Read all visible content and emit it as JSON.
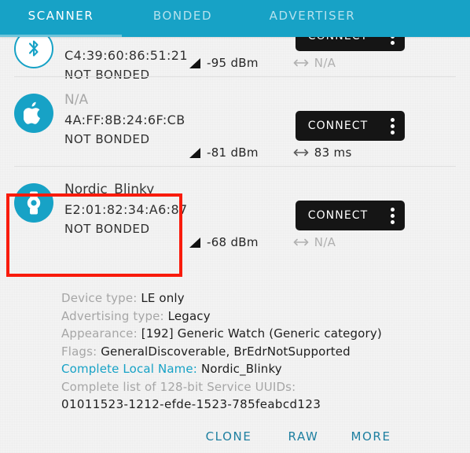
{
  "app": {
    "accent_color": "#17a2c6",
    "highlight_color": "#f91b0c",
    "link_color": "#1d7fa0"
  },
  "tabs": [
    {
      "id": "scanner",
      "label": "SCANNER",
      "active": true
    },
    {
      "id": "bonded",
      "label": "BONDED",
      "active": false
    },
    {
      "id": "advertiser",
      "label": "ADVERTISER",
      "active": false
    }
  ],
  "devices": [
    {
      "icon": "bluetooth-icon",
      "name": "",
      "address": "C4:39:60:86:51:21",
      "bond_state": "NOT BONDED",
      "rssi": "-95 dBm",
      "interval": "N/A",
      "connect_label": "CONNECT"
    },
    {
      "icon": "apple-icon",
      "name": "N/A",
      "address": "4A:FF:8B:24:6F:CB",
      "bond_state": "NOT BONDED",
      "rssi": "-81 dBm",
      "interval": "83 ms",
      "connect_label": "CONNECT"
    },
    {
      "icon": "watch-icon",
      "name": "Nordic_Blinky",
      "address": "E2:01:82:34:A6:87",
      "bond_state": "NOT BONDED",
      "rssi": "-68 dBm",
      "interval": "N/A",
      "connect_label": "CONNECT"
    }
  ],
  "details": {
    "device_type_label": "Device type:",
    "device_type_value": "LE only",
    "advertising_type_label": "Advertising type:",
    "advertising_type_value": "Legacy",
    "appearance_label": "Appearance:",
    "appearance_value": "[192] Generic Watch (Generic category)",
    "flags_label": "Flags:",
    "flags_value": "GeneralDiscoverable, BrEdrNotSupported",
    "local_name_label": "Complete Local Name:",
    "local_name_value": "Nordic_Blinky",
    "uuid_list_label": "Complete list of 128-bit Service UUIDs:",
    "uuid_value": "01011523-1212-efde-1523-785feabcd123"
  },
  "bottom_bar": {
    "clone": "CLONE",
    "raw": "RAW",
    "more": "MORE"
  }
}
